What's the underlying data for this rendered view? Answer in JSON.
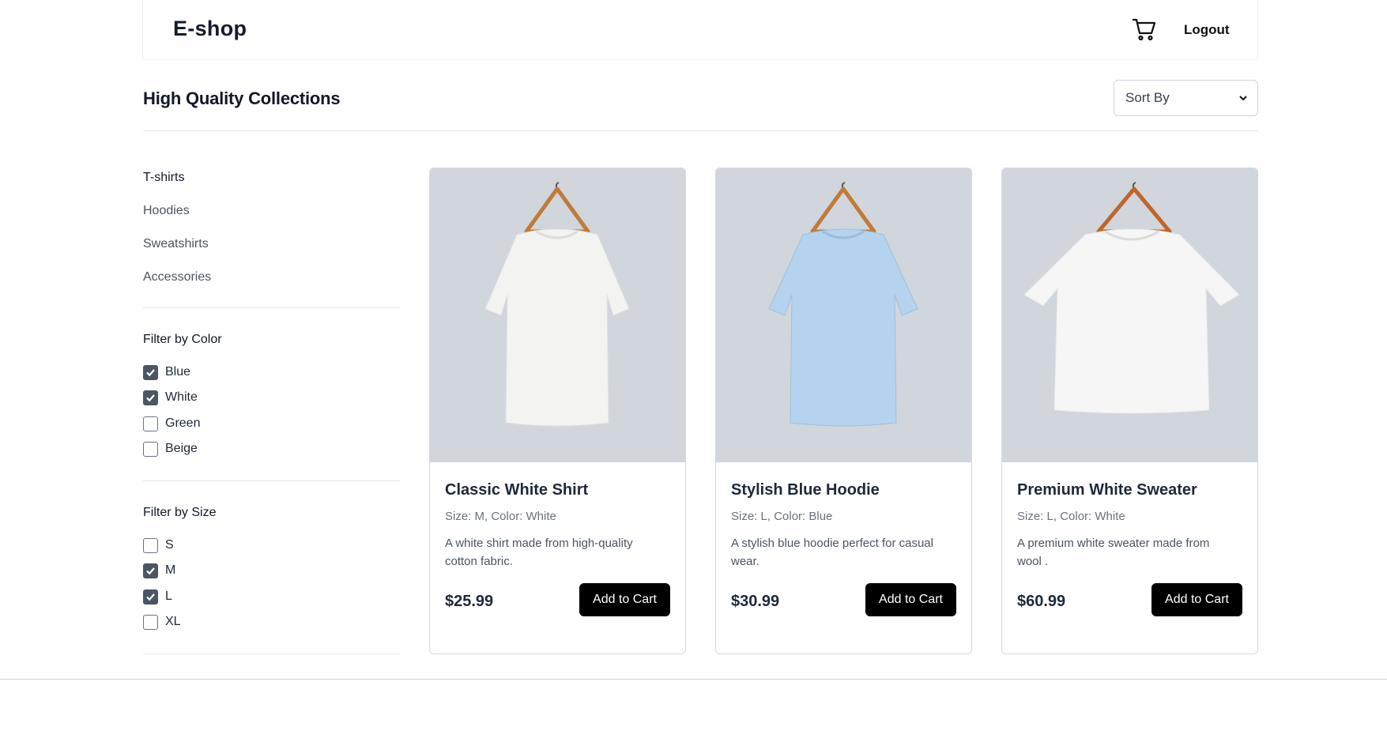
{
  "header": {
    "logo": "E-shop",
    "cart_icon": "cart-icon",
    "logout_label": "Logout"
  },
  "page": {
    "title": "High Quality Collections",
    "sort_label": "Sort By"
  },
  "sidebar": {
    "categories": [
      {
        "label": "T-shirts",
        "active": true
      },
      {
        "label": "Hoodies",
        "active": false
      },
      {
        "label": "Sweatshirts",
        "active": false
      },
      {
        "label": "Accessories",
        "active": false
      }
    ],
    "color_filter": {
      "title": "Filter by Color",
      "options": [
        {
          "label": "Blue",
          "checked": true
        },
        {
          "label": "White",
          "checked": true
        },
        {
          "label": "Green",
          "checked": false
        },
        {
          "label": "Beige",
          "checked": false
        }
      ]
    },
    "size_filter": {
      "title": "Filter by Size",
      "options": [
        {
          "label": "S",
          "checked": false
        },
        {
          "label": "M",
          "checked": true
        },
        {
          "label": "L",
          "checked": true
        },
        {
          "label": "XL",
          "checked": false
        }
      ]
    }
  },
  "products": [
    {
      "name": "Classic White Shirt",
      "meta": "Size: M, Color: White",
      "description": "A white shirt made from high-quality cotton fabric.",
      "price": "$25.99",
      "button": "Add to Cart",
      "shirt_color": "#f3f3f1"
    },
    {
      "name": "Stylish Blue Hoodie",
      "meta": "Size: L, Color: Blue",
      "description": "A stylish blue hoodie perfect for casual wear.",
      "price": "$30.99",
      "button": "Add to Cart",
      "shirt_color": "#b5d3ee"
    },
    {
      "name": "Premium White Sweater",
      "meta": "Size: L, Color: White",
      "description": "A premium white sweater made from wool .",
      "price": "$60.99",
      "button": "Add to Cart",
      "shirt_color": "#f6f6f6"
    }
  ],
  "colors": {
    "image_bg": "#d1d5dc",
    "button_bg": "#000000",
    "checkbox_checked": "#4b5563"
  }
}
